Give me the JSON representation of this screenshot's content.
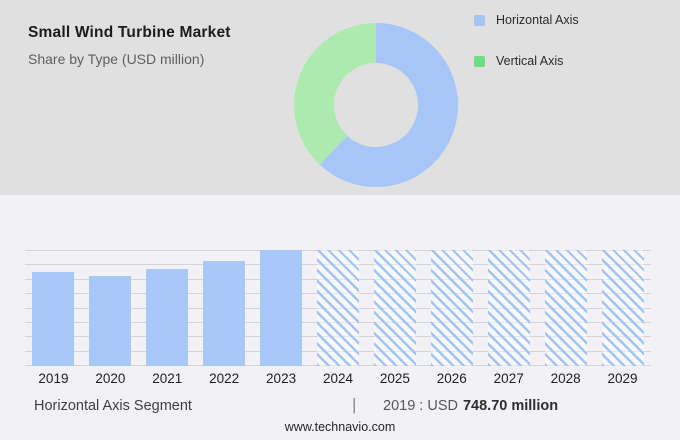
{
  "header": {
    "title": "Small Wind Turbine Market",
    "subtitle": "Share by Type (USD million)"
  },
  "legend": {
    "items": [
      {
        "label": "Horizontal Axis",
        "color": "#a5c3f3"
      },
      {
        "label": "Vertical Axis",
        "color": "#6edd85"
      }
    ]
  },
  "chart_data": [
    {
      "type": "pie",
      "title": "Share by Type (USD million)",
      "donut": true,
      "slices": [
        {
          "label": "Horizontal Axis",
          "percent": 62,
          "color": "#a5c6f7"
        },
        {
          "label": "Vertical Axis",
          "percent": 38,
          "color": "#aceab0"
        }
      ],
      "legend_position": "right"
    },
    {
      "type": "bar",
      "title": "Market size by year (USD million, estimated from bars; 2019 labeled as 748.70)",
      "categories": [
        "2019",
        "2020",
        "2021",
        "2022",
        "2023",
        "2024",
        "2025",
        "2026",
        "2027",
        "2028",
        "2029"
      ],
      "series": [
        {
          "name": "Horizontal Axis segment market size",
          "values": [
            748.7,
            710,
            772,
            834,
            920,
            920,
            920,
            920,
            920,
            920,
            920
          ]
        }
      ],
      "forecast_start_index": 5,
      "forecast_style": "diagonal-hatch",
      "ylim": [
        0,
        920
      ],
      "grid": true,
      "gridline_count": 9,
      "bar_color": "#a8c8f8",
      "hatch_color": "#a2c4f6"
    }
  ],
  "footer": {
    "segment_label": "Horizontal Axis Segment",
    "separator": "|",
    "value_prefix": "2019 : USD",
    "value_bold": "748.70 million",
    "website": "www.technavio.com"
  },
  "colors": {
    "top_bg": "#e0e0e0",
    "bottom_bg": "#f2f2f6",
    "gridline": "#d4d4d6"
  }
}
